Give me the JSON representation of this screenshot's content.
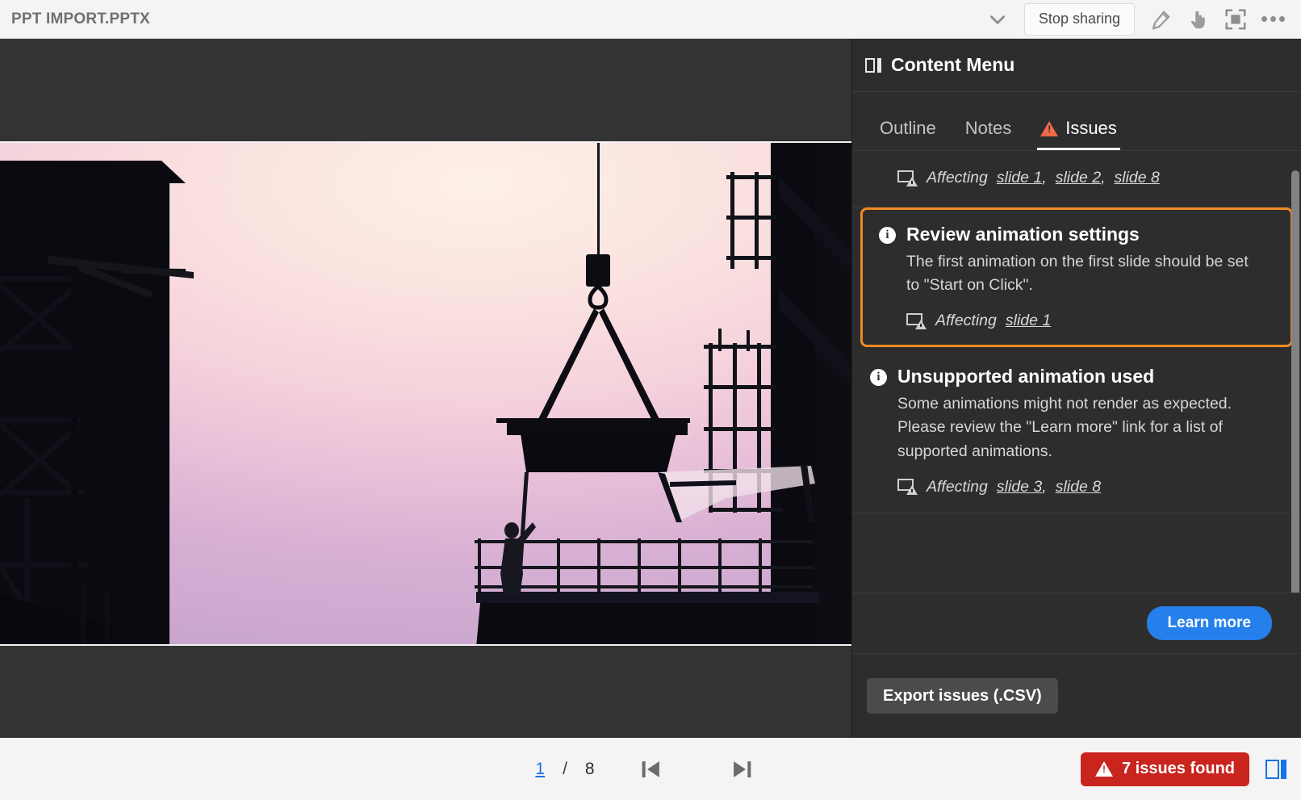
{
  "topbar": {
    "doc_title": "PPT IMPORT.PPTX",
    "chevron_icon": "chevron-down-icon",
    "stop_sharing_label": "Stop sharing",
    "annotate_icon": "pencil-icon",
    "pointer_icon": "hand-pointer-icon",
    "fullscreen_icon": "fullscreen-icon",
    "more_icon": "more-options-icon"
  },
  "panel": {
    "icon": "panel-layout-icon",
    "title": "Content Menu",
    "tabs": [
      {
        "label": "Outline",
        "active": false,
        "icon": null
      },
      {
        "label": "Notes",
        "active": false,
        "icon": null
      },
      {
        "label": "Issues",
        "active": true,
        "icon": "warning-triangle-icon"
      }
    ],
    "issues": [
      {
        "partial": true,
        "highlighted": false,
        "title": "",
        "description": "",
        "affecting_label": "Affecting",
        "affecting_icon": "slide-warning-icon",
        "slides": [
          "slide 1",
          "slide 2",
          "slide 8"
        ]
      },
      {
        "partial": false,
        "highlighted": true,
        "icon": "info-icon",
        "title": "Review animation settings",
        "description": "The first animation on the first slide should be set to \"Start on Click\".",
        "affecting_label": "Affecting",
        "affecting_icon": "slide-warning-icon",
        "slides": [
          "slide 1"
        ]
      },
      {
        "partial": false,
        "highlighted": false,
        "icon": "info-icon",
        "title": "Unsupported animation used",
        "description": "Some animations might not render as expected. Please review the \"Learn more\" link for a list of supported animations.",
        "affecting_label": "Affecting",
        "affecting_icon": "slide-warning-icon",
        "slides": [
          "slide 3",
          "slide 8"
        ]
      }
    ],
    "learn_more_label": "Learn more",
    "export_label": "Export issues (.CSV)",
    "scrollbar": "vertical-scrollbar"
  },
  "bottombar": {
    "page_current": "1",
    "page_separator": "/",
    "page_total": "8",
    "prev_icon": "previous-slide-icon",
    "next_icon": "next-slide-icon",
    "issues_badge_label": "7 issues found",
    "issues_badge_icon": "warning-triangle-icon",
    "panel_toggle_icon": "toggle-panel-icon"
  },
  "slide": {
    "alt": "construction-site-silhouette-at-dusk"
  },
  "colors": {
    "accent_blue": "#1473e6",
    "button_blue": "#2680eb",
    "warning_orange": "#f06a48",
    "highlight_orange": "#f08a22",
    "error_red": "#c9241e",
    "panel_bg": "#2d2d2d",
    "stage_bg": "#333333",
    "chrome_bg": "#f4f4f4"
  }
}
